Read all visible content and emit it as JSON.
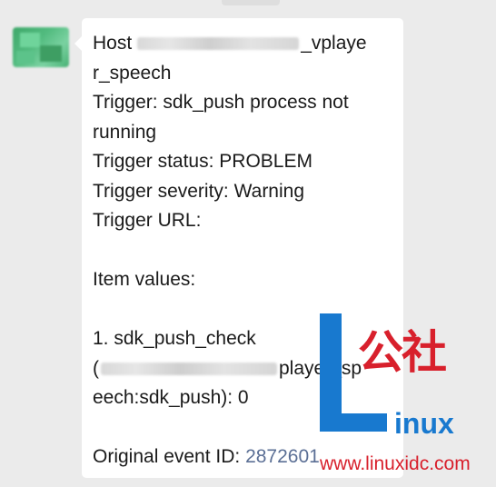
{
  "message": {
    "host_prefix": "Host",
    "host_suffix": "_vplaye",
    "host_line2": "r_speech",
    "trigger": "Trigger: sdk_push process not",
    "trigger_cont": "running",
    "trigger_status": "Trigger status: PROBLEM",
    "trigger_severity": "Trigger severity: Warning",
    "trigger_url": "Trigger URL:",
    "item_values": "Item values:",
    "item1": "1. sdk_push_check",
    "item1_open": "(",
    "item1_suffix": "player_sp",
    "item1_line3": "eech:sdk_push): 0",
    "event_label": "Original event ID: ",
    "event_id": "2872601"
  },
  "watermark": {
    "chinese": "公社",
    "inux": "inux",
    "url": "www.linuxidc.com"
  },
  "colors": {
    "background": "#ebebeb",
    "bubble": "#ffffff",
    "link": "#5b6f95",
    "watermark_blue": "#1879cf",
    "watermark_red": "#d8202c",
    "avatar_green": "#52bb7f"
  }
}
